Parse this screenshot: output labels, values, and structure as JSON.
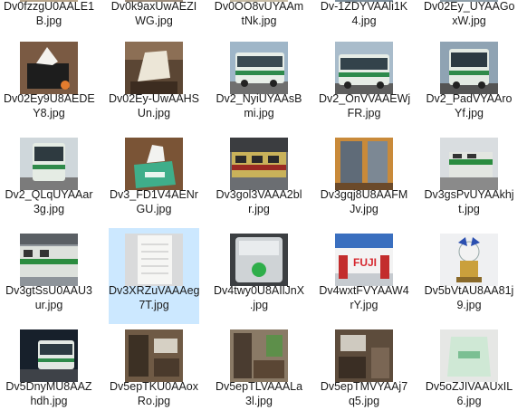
{
  "files": [
    {
      "l1": "Dv0fzzgU0AALE1",
      "l2": "B.jpg",
      "icon": "photo-thumbnail-icon"
    },
    {
      "l1": "Dv0k9axUwAEZI",
      "l2": "WG.jpg",
      "icon": "photo-thumbnail-icon"
    },
    {
      "l1": "Dv0OO8vUYAAm",
      "l2": "tNk.jpg",
      "icon": "photo-thumbnail-icon"
    },
    {
      "l1": "Dv-1ZDYVAAli1K",
      "l2": "4.jpg",
      "icon": "photo-thumbnail-icon"
    },
    {
      "l1": "Dv02Ey_UYAAGo",
      "l2": "xW.jpg",
      "icon": "photo-thumbnail-icon"
    },
    {
      "l1": "Dv02Ey9U8AEDE",
      "l2": "Y8.jpg",
      "icon": "tissue-box-photo-icon"
    },
    {
      "l1": "Dv02Ey-UwAAHS",
      "l2": "Un.jpg",
      "icon": "tissue-box-photo-icon"
    },
    {
      "l1": "Dv2_NyiUYAAsB",
      "l2": "mi.jpg",
      "icon": "bus-photo-icon"
    },
    {
      "l1": "Dv2_OnVVAAEWj",
      "l2": "FR.jpg",
      "icon": "bus-photo-icon"
    },
    {
      "l1": "Dv2_PadVYAAro",
      "l2": "Yf.jpg",
      "icon": "bus-photo-icon"
    },
    {
      "l1": "Dv2_QLqUYAAar",
      "l2": "3g.jpg",
      "icon": "bus-photo-icon"
    },
    {
      "l1": "Dv3_FD1V4AENr",
      "l2": "GU.jpg",
      "icon": "tissue-box-photo-icon"
    },
    {
      "l1": "Dv3gol3VAAA2bl",
      "l2": "r.jpg",
      "icon": "train-photo-icon"
    },
    {
      "l1": "Dv3gqj8U8AAFM",
      "l2": "Jv.jpg",
      "icon": "train-interior-photo-icon"
    },
    {
      "l1": "Dv3gsPvUYAAkhj",
      "l2": "t.jpg",
      "icon": "train-photo-icon"
    },
    {
      "l1": "Dv3gtSsU0AAU3",
      "l2": "ur.jpg",
      "icon": "train-photo-icon"
    },
    {
      "l1": "Dv3XRZuVAAAeg",
      "l2": "7T.jpg",
      "icon": "paper-photo-icon"
    },
    {
      "l1": "Dv4twy0U8AIlJnX",
      "l2": ".jpg",
      "icon": "device-photo-icon"
    },
    {
      "l1": "Dv4wxtFVYAAW4",
      "l2": "rY.jpg",
      "icon": "event-photo-icon"
    },
    {
      "l1": "Dv5bVtAU8AA81j",
      "l2": "9.jpg",
      "icon": "figure-photo-icon"
    },
    {
      "l1": "Dv5DnyMU8AAZ",
      "l2": "hdh.jpg",
      "icon": "bus-photo-icon"
    },
    {
      "l1": "Dv5epTKU0AAox",
      "l2": "Ro.jpg",
      "icon": "room-photo-icon"
    },
    {
      "l1": "Dv5epTLVAAALa",
      "l2": "3l.jpg",
      "icon": "room-photo-icon"
    },
    {
      "l1": "Dv5epTMVYAAj7",
      "l2": "q5.jpg",
      "icon": "room-photo-icon"
    },
    {
      "l1": "Dv5oZJIVAAUxIL",
      "l2": "6.jpg",
      "icon": "towel-photo-icon"
    }
  ],
  "selected_index": 16
}
